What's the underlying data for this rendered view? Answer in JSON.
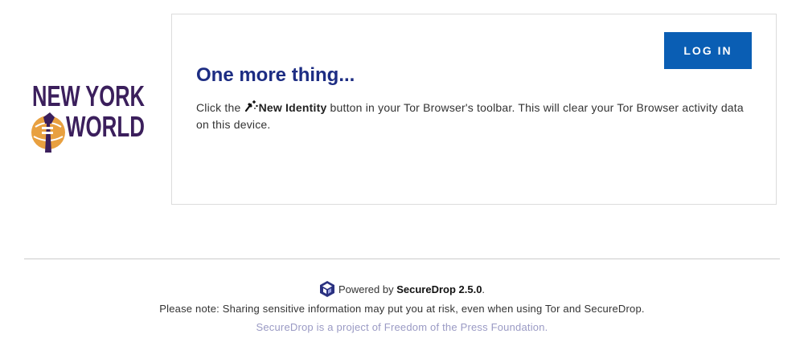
{
  "brand": {
    "logo_line1": "NEW YORK",
    "logo_line2": "WORLD",
    "logo_color": "#3b1f5c",
    "logo_accent": "#e8a040"
  },
  "card": {
    "login_label": "LOG IN",
    "title": "One more thing...",
    "body_prefix": "Click the ",
    "body_icon": "broom-sparkle-icon",
    "body_strong": "New Identity",
    "body_suffix": " button in your Tor Browser's toolbar. This will clear your Tor Browser activity data on this device."
  },
  "footer": {
    "powered_prefix": "Powered by ",
    "product": "SecureDrop 2.5.0",
    "powered_suffix": ".",
    "note": "Please note: Sharing sensitive information may put you at risk, even when using Tor and SecureDrop.",
    "fpf": "SecureDrop is a project of Freedom of the Press Foundation."
  },
  "colors": {
    "accent": "#0a5eb4",
    "title": "#1d2d83",
    "muted_link": "#9a9ac4",
    "securedrop_icon": "#2a3180"
  }
}
